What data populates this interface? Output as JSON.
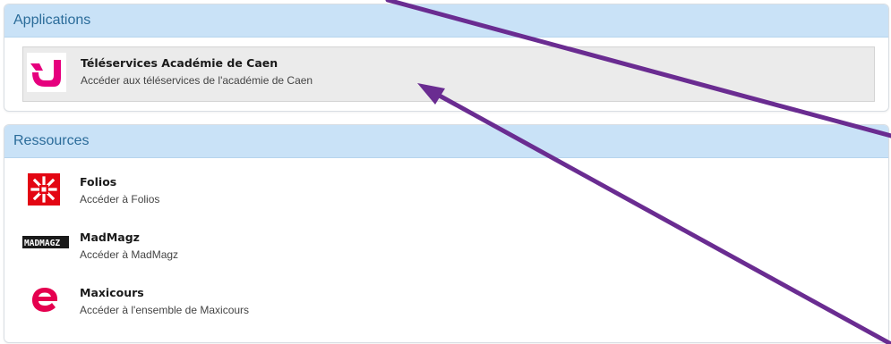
{
  "applications": {
    "title": "Applications",
    "items": [
      {
        "title": "Téléservices Académie de Caen",
        "description": "Accéder aux téléservices de l'académie de Caen",
        "icon": "teleservices-logo-icon"
      }
    ]
  },
  "resources": {
    "title": "Ressources",
    "items": [
      {
        "title": "Folios",
        "description": "Accéder à Folios",
        "icon": "folios-logo-icon"
      },
      {
        "title": "MadMagz",
        "description": "Accéder à MadMagz",
        "icon": "madmagz-logo-icon",
        "logo_text": "MADMAGZ"
      },
      {
        "title": "Maxicours",
        "description": "Accéder à l'ensemble de Maxicours",
        "icon": "maxicours-logo-icon"
      }
    ]
  },
  "colors": {
    "header_bg": "#c9e2f7",
    "header_text": "#2b6c9a",
    "selected_item_bg": "#ebebeb",
    "annotation_arrow": "#6a2c91",
    "teleservices_pink": "#e6007e",
    "folios_red": "#e30613",
    "maxicours_pink": "#e5004f"
  }
}
